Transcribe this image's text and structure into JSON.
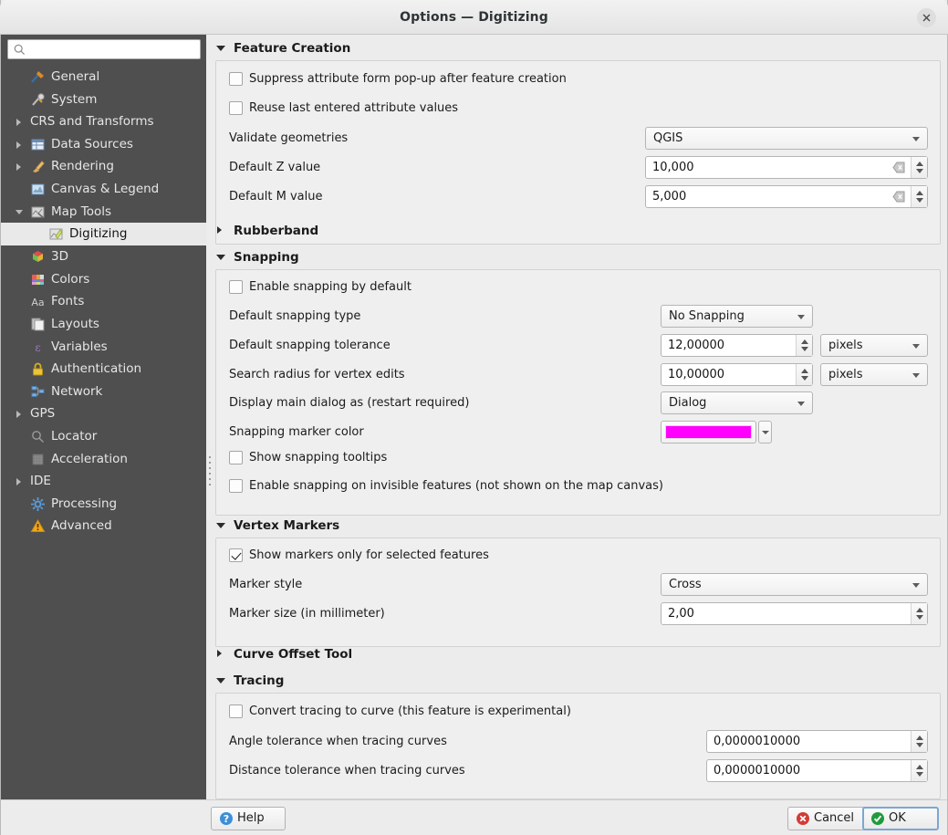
{
  "window": {
    "title": "Options — Digitizing",
    "close_icon": "close-icon"
  },
  "sidebar": {
    "search": {
      "placeholder": "",
      "value": "",
      "icon": "search-icon"
    },
    "items": [
      {
        "label": "General",
        "icon": "hammer-wrench-icon",
        "level": 0,
        "arrow": "none",
        "selected": false
      },
      {
        "label": "System",
        "icon": "gear-wrench-icon",
        "level": 0,
        "arrow": "none",
        "selected": false
      },
      {
        "label": "CRS and Transforms",
        "icon": "none",
        "level": 0,
        "arrow": "collapsed",
        "selected": false
      },
      {
        "label": "Data Sources",
        "icon": "table-icon",
        "level": 0,
        "arrow": "collapsed",
        "selected": false
      },
      {
        "label": "Rendering",
        "icon": "paintbrush-icon",
        "level": 0,
        "arrow": "collapsed",
        "selected": false
      },
      {
        "label": "Canvas & Legend",
        "icon": "canvas-legend-icon",
        "level": 0,
        "arrow": "none",
        "selected": false
      },
      {
        "label": "Map Tools",
        "icon": "map-tools-icon",
        "level": 0,
        "arrow": "expanded",
        "selected": false
      },
      {
        "label": "Digitizing",
        "icon": "digitizing-icon",
        "level": 1,
        "arrow": "none",
        "selected": true
      },
      {
        "label": "3D",
        "icon": "cube-icon",
        "level": 0,
        "arrow": "none",
        "selected": false
      },
      {
        "label": "Colors",
        "icon": "color-palette-icon",
        "level": 0,
        "arrow": "none",
        "selected": false
      },
      {
        "label": "Fonts",
        "icon": "font-aa-icon",
        "level": 0,
        "arrow": "none",
        "selected": false
      },
      {
        "label": "Layouts",
        "icon": "layouts-icon",
        "level": 0,
        "arrow": "none",
        "selected": false
      },
      {
        "label": "Variables",
        "icon": "variable-epsilon-icon",
        "level": 0,
        "arrow": "none",
        "selected": false
      },
      {
        "label": "Authentication",
        "icon": "lock-icon",
        "level": 0,
        "arrow": "none",
        "selected": false
      },
      {
        "label": "Network",
        "icon": "network-icon",
        "level": 0,
        "arrow": "none",
        "selected": false
      },
      {
        "label": "GPS",
        "icon": "none",
        "level": 0,
        "arrow": "collapsed",
        "selected": false
      },
      {
        "label": "Locator",
        "icon": "search-icon",
        "level": 0,
        "arrow": "none",
        "selected": false
      },
      {
        "label": "Acceleration",
        "icon": "acceleration-icon",
        "level": 0,
        "arrow": "none",
        "selected": false
      },
      {
        "label": "IDE",
        "icon": "none",
        "level": 0,
        "arrow": "collapsed",
        "selected": false
      },
      {
        "label": "Processing",
        "icon": "gear-processing-icon",
        "level": 0,
        "arrow": "none",
        "selected": false
      },
      {
        "label": "Advanced",
        "icon": "warning-triangle-icon",
        "level": 0,
        "arrow": "none",
        "selected": false
      }
    ]
  },
  "sections": {
    "feature_creation": {
      "title": "Feature Creation",
      "expanded": true,
      "suppress_popup": {
        "label": "Suppress attribute form pop-up after feature creation",
        "checked": false
      },
      "reuse_values": {
        "label": "Reuse last entered attribute values",
        "checked": false
      },
      "validate_geometries": {
        "label": "Validate geometries",
        "value": "QGIS"
      },
      "default_z": {
        "label": "Default Z value",
        "value": "10,000"
      },
      "default_m": {
        "label": "Default M value",
        "value": "5,000"
      }
    },
    "rubberband": {
      "title": "Rubberband",
      "expanded": false
    },
    "snapping": {
      "title": "Snapping",
      "expanded": true,
      "enable_default": {
        "label": "Enable snapping by default",
        "checked": false
      },
      "snapping_type": {
        "label": "Default snapping type",
        "value": "No Snapping"
      },
      "tolerance": {
        "label": "Default snapping tolerance",
        "value": "12,00000",
        "unit": "pixels"
      },
      "search_radius": {
        "label": "Search radius for vertex edits",
        "value": "10,00000",
        "unit": "pixels"
      },
      "main_dialog": {
        "label": "Display main dialog as (restart required)",
        "value": "Dialog"
      },
      "marker_color": {
        "label": "Snapping marker color",
        "color": "#FF00FF"
      },
      "show_tooltips": {
        "label": "Show snapping tooltips",
        "checked": false
      },
      "invisible_features": {
        "label": "Enable snapping on invisible features (not shown on the map canvas)",
        "checked": false
      }
    },
    "vertex_markers": {
      "title": "Vertex Markers",
      "expanded": true,
      "selected_only": {
        "label": "Show markers only for selected features",
        "checked": true
      },
      "marker_style": {
        "label": "Marker style",
        "value": "Cross"
      },
      "marker_size": {
        "label": "Marker size (in millimeter)",
        "value": "2,00"
      }
    },
    "curve_offset_tool": {
      "title": "Curve Offset Tool",
      "expanded": false
    },
    "tracing": {
      "title": "Tracing",
      "expanded": true,
      "convert_to_curve": {
        "label": "Convert tracing to curve (this feature is experimental)",
        "checked": false
      },
      "angle_tolerance": {
        "label": "Angle tolerance when tracing curves",
        "value": "0,0000010000"
      },
      "distance_tolerance": {
        "label": "Distance tolerance when tracing curves",
        "value": "0,0000010000"
      }
    }
  },
  "buttons": {
    "help": {
      "label": "Help",
      "icon": "help-question-icon"
    },
    "cancel": {
      "label": "Cancel",
      "icon": "cancel-x-icon"
    },
    "ok": {
      "label": "OK",
      "icon": "ok-check-icon"
    }
  }
}
